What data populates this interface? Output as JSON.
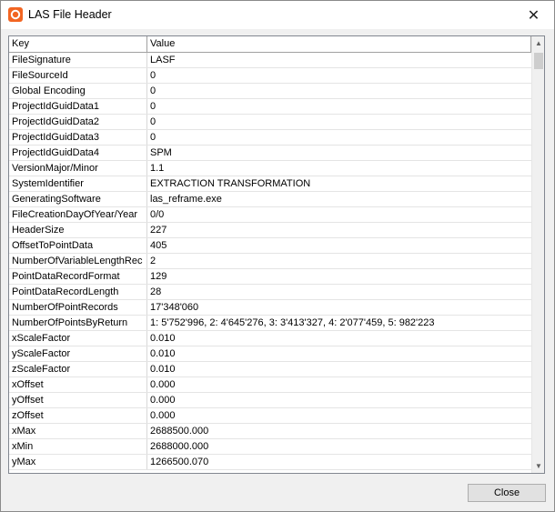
{
  "window": {
    "title": "LAS File Header",
    "close_glyph": "✕",
    "accent": "#f26522"
  },
  "table": {
    "columns": [
      "Key",
      "Value"
    ],
    "rows": [
      {
        "key": "FileSignature",
        "value": "LASF"
      },
      {
        "key": "FileSourceId",
        "value": "0"
      },
      {
        "key": "Global Encoding",
        "value": "0"
      },
      {
        "key": "ProjectIdGuidData1",
        "value": "0"
      },
      {
        "key": "ProjectIdGuidData2",
        "value": "0"
      },
      {
        "key": "ProjectIdGuidData3",
        "value": "0"
      },
      {
        "key": "ProjectIdGuidData4",
        "value": "SPM"
      },
      {
        "key": "VersionMajor/Minor",
        "value": "1.1"
      },
      {
        "key": "SystemIdentifier",
        "value": "EXTRACTION TRANSFORMATION"
      },
      {
        "key": "GeneratingSoftware",
        "value": "las_reframe.exe"
      },
      {
        "key": "FileCreationDayOfYear/Year",
        "value": "0/0"
      },
      {
        "key": "HeaderSize",
        "value": "227"
      },
      {
        "key": "OffsetToPointData",
        "value": "405"
      },
      {
        "key": "NumberOfVariableLengthRec",
        "value": "2"
      },
      {
        "key": "PointDataRecordFormat",
        "value": "129"
      },
      {
        "key": "PointDataRecordLength",
        "value": "28"
      },
      {
        "key": "NumberOfPointRecords",
        "value": "17'348'060"
      },
      {
        "key": "NumberOfPointsByReturn",
        "value": "1: 5'752'996,  2: 4'645'276,  3: 3'413'327,  4: 2'077'459,  5: 982'223"
      },
      {
        "key": "xScaleFactor",
        "value": "0.010"
      },
      {
        "key": "yScaleFactor",
        "value": "0.010"
      },
      {
        "key": "zScaleFactor",
        "value": "0.010"
      },
      {
        "key": "xOffset",
        "value": "0.000"
      },
      {
        "key": "yOffset",
        "value": "0.000"
      },
      {
        "key": "zOffset",
        "value": "0.000"
      },
      {
        "key": "xMax",
        "value": "2688500.000"
      },
      {
        "key": "xMin",
        "value": "2688000.000"
      },
      {
        "key": "yMax",
        "value": "1266500.070"
      }
    ]
  },
  "scrollbar": {
    "up_icon": "▲",
    "down_icon": "▼"
  },
  "footer": {
    "close_label": "Close"
  }
}
